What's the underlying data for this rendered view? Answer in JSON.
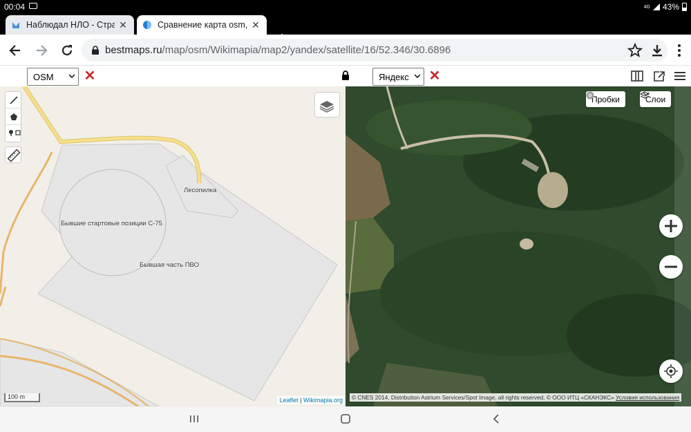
{
  "status": {
    "time": "00:04",
    "network": "4G",
    "battery": "43%"
  },
  "tabs": [
    {
      "title": "Наблюдал НЛО - Страни",
      "close": "✕"
    },
    {
      "title": "Сравнение карта osm, ya",
      "close": "✕"
    }
  ],
  "new_tab": "+",
  "omnibox": {
    "host": "bestmaps.ru",
    "path": "/map/osm/Wikimapia/map2/yandex/satellite/16/52.346/30.6896"
  },
  "left_panel": {
    "provider_select": "OSM",
    "labels": {
      "sawmill": "Лесопилка",
      "launch_sites": "Бывшие стартовые позиции С-75",
      "air_defense": "Бывшая часть ПВО"
    },
    "scale": "100 m",
    "attribution_leaflet": "Leaflet",
    "attribution_sep": " | ",
    "attribution_wikimapia": "Wikimapia.org"
  },
  "right_panel": {
    "provider_select": "Яндекс",
    "traffic_button": "Пробки",
    "layers_button": "Слои",
    "attribution": "© CNES 2014, Distribution Astrium Services/Spot Image, all rights reserved, © ООО ИТЦ «СКАНЭКС»",
    "terms_link": "Условия использования"
  },
  "colors": {
    "road": "#f7e08c",
    "road_casing": "#e0c266",
    "orange_road": "#e9b56a",
    "area_fill": "#e6e6e6",
    "area_stroke": "#c8c8c8",
    "close_red": "#c62828",
    "forest": "#2f4a2c"
  }
}
